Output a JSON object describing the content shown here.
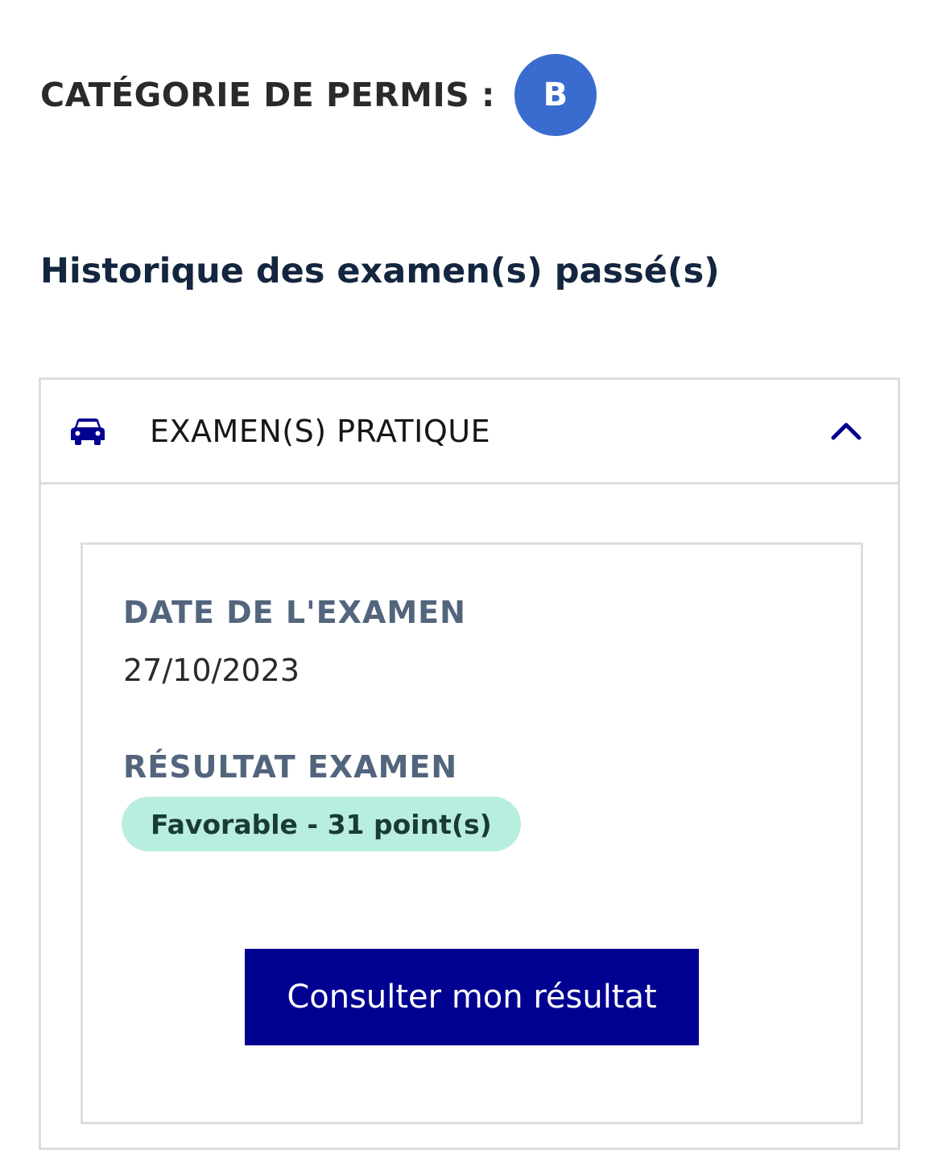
{
  "category": {
    "label": "CATÉGORIE DE PERMIS :",
    "value": "B",
    "badge_color": "#3a6ccf"
  },
  "history": {
    "title": "Historique des examen(s) passé(s)"
  },
  "accordion": {
    "title": "EXAMEN(S) PRATIQUE",
    "leading_icon": "car-icon",
    "toggle_icon": "chevron-up-icon",
    "expanded": true,
    "icon_color": "#000091"
  },
  "exam": {
    "date_label": "DATE DE L'EXAMEN",
    "date_value": "27/10/2023",
    "result_label": "RÉSULTAT EXAMEN",
    "result_value": "Favorable - 31 point(s)",
    "result_badge_color": "#b8eedf",
    "button_label": "Consulter mon résultat",
    "button_color": "#000091"
  }
}
